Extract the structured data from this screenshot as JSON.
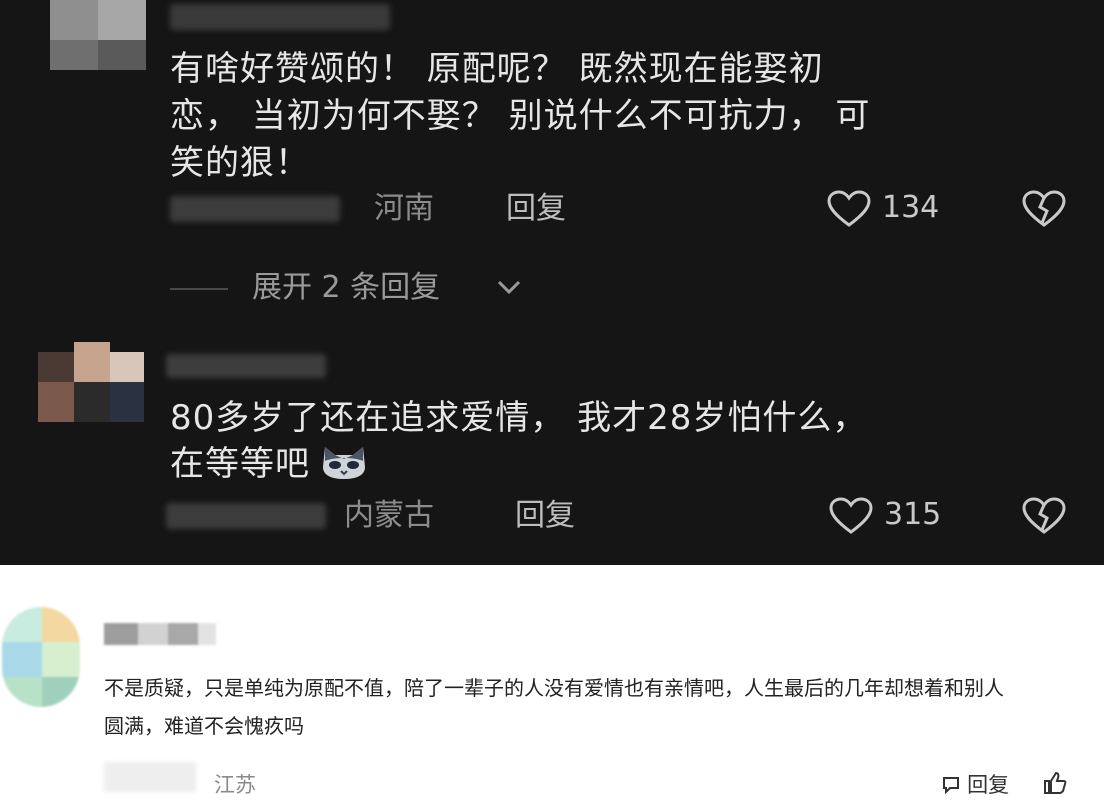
{
  "comments_dark": [
    {
      "text_line1": "有啥好赞颂的！ 原配呢？ 既然现在能娶初",
      "text_line2": "恋， 当初为何不娶？ 别说什么不可抗力， 可",
      "text_line3": "笑的狠！",
      "location": "河南",
      "reply_label": "回复",
      "like_count": "134"
    },
    {
      "text_line1": "80多岁了还在追求爱情， 我才28岁怕什么，",
      "text_line2": "在等等吧",
      "location": "内蒙古",
      "reply_label": "回复",
      "like_count": "315"
    }
  ],
  "expand_replies_label": "展开 2 条回复",
  "comment_light": {
    "text_line1": "不是质疑，只是单纯为原配不值，陪了一辈子的人没有爱情也有亲情吧，人生最后的几年却想着和别人",
    "text_line2": "圆满，难道不会愧疚吗",
    "location": "江苏",
    "reply_label": "回复"
  },
  "icons": {
    "like": "heart-outline-icon",
    "dislike": "broken-heart-icon",
    "expand": "chevron-down-icon",
    "emoji": "cat-face-emoji-icon"
  }
}
